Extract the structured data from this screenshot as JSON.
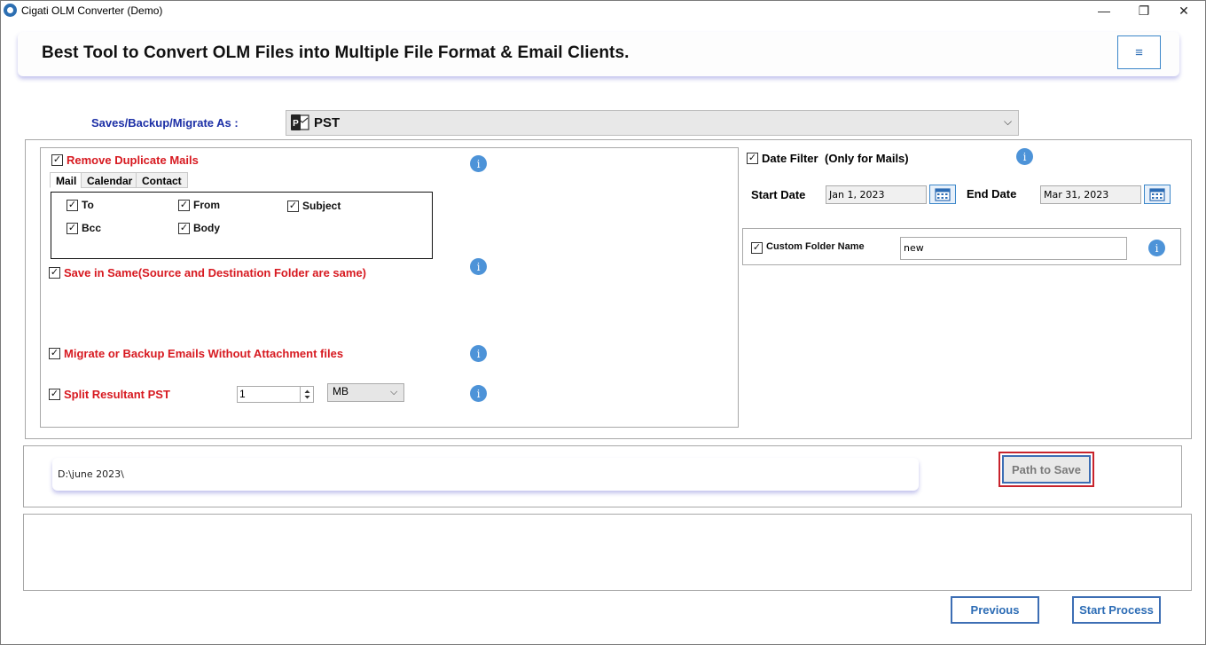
{
  "window": {
    "title": "Cigati OLM Converter (Demo)",
    "minimize": "—",
    "maximize": "❐",
    "close": "✕"
  },
  "header": {
    "title": "Best Tool to Convert OLM Files into Multiple File Format & Email Clients.",
    "menu_glyph": "≡"
  },
  "save_as": {
    "label": "Saves/Backup/Migrate As :",
    "selected": "PST",
    "chevron": "⌵"
  },
  "options": {
    "remove_duplicates": {
      "label": "Remove Duplicate Mails",
      "checked": true
    },
    "tabs": [
      "Mail",
      "Calendar",
      "Contact"
    ],
    "mail_fields": {
      "to": "To",
      "from": "From",
      "subject": "Subject",
      "bcc": "Bcc",
      "body": "Body"
    },
    "save_in_same": {
      "label": "Save in Same(Source and Destination Folder are same)",
      "checked": true
    },
    "without_attachments": {
      "label": "Migrate or Backup Emails Without Attachment files",
      "checked": true
    },
    "split": {
      "label": "Split Resultant PST",
      "checked": true,
      "size": "1",
      "unit": "MB"
    }
  },
  "date_filter": {
    "label": "Date Filter",
    "note": "(Only for Mails)",
    "checked": true,
    "start_label": "Start Date",
    "start_value": "Jan 1, 2023",
    "end_label": "End Date",
    "end_value": "Mar 31, 2023"
  },
  "custom_folder": {
    "label": "Custom Folder Name",
    "checked": true,
    "value": "new"
  },
  "info_glyph": "i",
  "check_glyph": "✓",
  "path": {
    "value": "D:\\june 2023\\",
    "button": "Path to Save"
  },
  "footer": {
    "previous": "Previous",
    "start": "Start Process"
  },
  "colors": {
    "accent_blue": "#3d6eb4",
    "label_red": "#d71920",
    "label_navy": "#1c2fa6",
    "highlight_red": "#c8232c"
  }
}
